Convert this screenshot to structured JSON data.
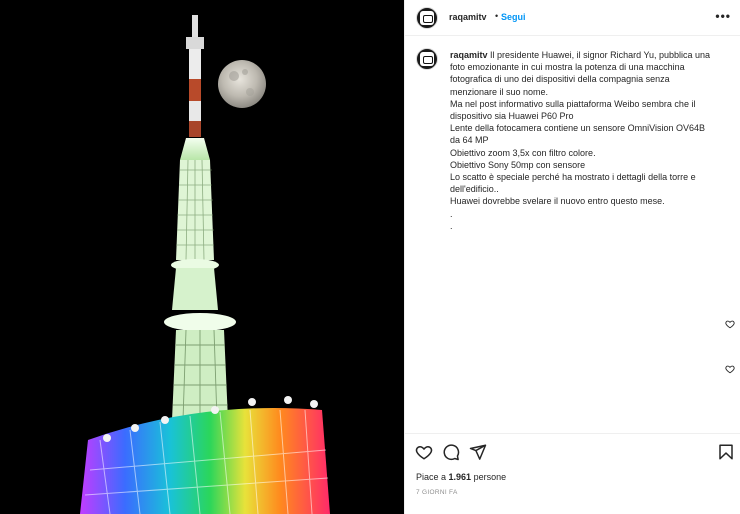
{
  "post": {
    "username": "raqamitv",
    "separator": "•",
    "follow_label": "Segui",
    "more_label": "•••",
    "caption_username": "raqamitv",
    "caption_lines": [
      "Il presidente Huawei, il signor Richard Yu, pubblica una",
      "foto emozionante in cui mostra la potenza di una macchina",
      "fotografica di uno dei dispositivi della compagnia senza",
      "menzionare il suo nome.",
      "Ma nel post informativo sulla piattaforma Weibo sembra che il",
      "dispositivo sia Huawei P60 Pro",
      "Lente della fotocamera contiene un sensore OmniVision OV64B",
      "da 64 MP",
      "Obiettivo zoom 3,5x con filtro colore.",
      "Obiettivo Sony 50mp con sensore",
      "Lo scatto è speciale perché ha mostrato i dettagli della torre e",
      "dell'edificio..",
      "Huawei dovrebbe svelare il nuovo entro questo mese.",
      ".",
      "."
    ],
    "likes_prefix": "Piace a ",
    "likes_count": "1.961",
    "likes_suffix": " persone",
    "time_ago": "7 GIORNI FA"
  },
  "icons": {
    "like": "heart-icon",
    "comment": "comment-icon",
    "share": "share-icon",
    "save": "bookmark-icon",
    "more": "more-icon"
  },
  "colors": {
    "follow": "#0095f6",
    "text": "#262626",
    "muted": "#8e8e8e",
    "photo_bg": "#000000"
  }
}
